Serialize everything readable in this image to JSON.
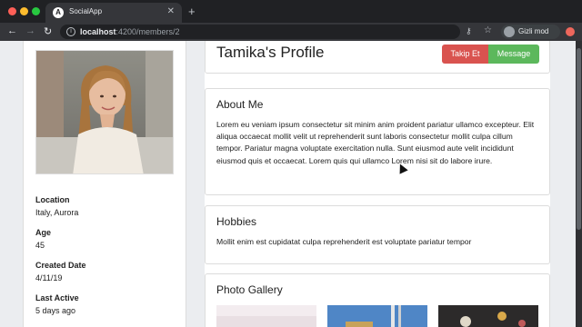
{
  "browser": {
    "tab_title": "SocialApp",
    "tab_favicon": "A",
    "url_host": "localhost",
    "url_path": ":4200/members/2",
    "incognito_label": "Gizli mod"
  },
  "profile": {
    "title": "Tamika's Profile",
    "follow_label": "Takip Et",
    "message_label": "Message",
    "info": [
      {
        "label": "Location",
        "value": "Italy, Aurora"
      },
      {
        "label": "Age",
        "value": "45"
      },
      {
        "label": "Created Date",
        "value": "4/11/19"
      },
      {
        "label": "Last Active",
        "value": "5 days ago"
      }
    ]
  },
  "about": {
    "title": "About Me",
    "text": "Lorem eu veniam ipsum consectetur sit minim anim proident pariatur ullamco excepteur. Elit aliqua occaecat mollit velit ut reprehenderit sunt laboris consectetur mollit culpa cillum tempor. Pariatur magna voluptate exercitation nulla. Sunt eiusmod aute velit incididunt eiusmod quis et occaecat. Lorem quis qui ullamco Lorem nisi sit do labore irure."
  },
  "hobbies": {
    "title": "Hobbies",
    "text": "Mollit enim est cupidatat culpa reprehenderit est voluptate pariatur tempor"
  },
  "gallery": {
    "title": "Photo Gallery"
  },
  "colors": {
    "follow": "#d9534f",
    "message": "#5cb85c",
    "page_bg": "#ebedf0"
  }
}
